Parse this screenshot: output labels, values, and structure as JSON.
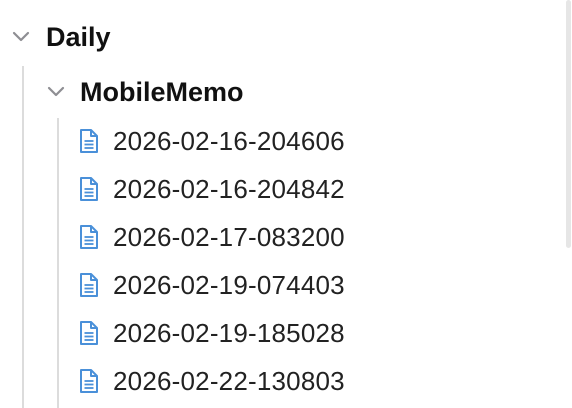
{
  "tree": {
    "root": {
      "label": "Daily",
      "expanded": true,
      "chevron_icon": "chevron-down-icon"
    },
    "child_folder": {
      "label": "MobileMemo",
      "expanded": true,
      "chevron_icon": "chevron-down-icon"
    },
    "files": [
      {
        "label": "2026-02-16-204606",
        "icon": "document-icon"
      },
      {
        "label": "2026-02-16-204842",
        "icon": "document-icon"
      },
      {
        "label": "2026-02-17-083200",
        "icon": "document-icon"
      },
      {
        "label": "2026-02-19-074403",
        "icon": "document-icon"
      },
      {
        "label": "2026-02-19-185028",
        "icon": "document-icon"
      },
      {
        "label": "2026-02-22-130803",
        "icon": "document-icon"
      }
    ]
  },
  "colors": {
    "icon_blue": "#4a90d9",
    "chevron_gray": "#8e8e93",
    "guide_line": "#dcdcdc"
  }
}
